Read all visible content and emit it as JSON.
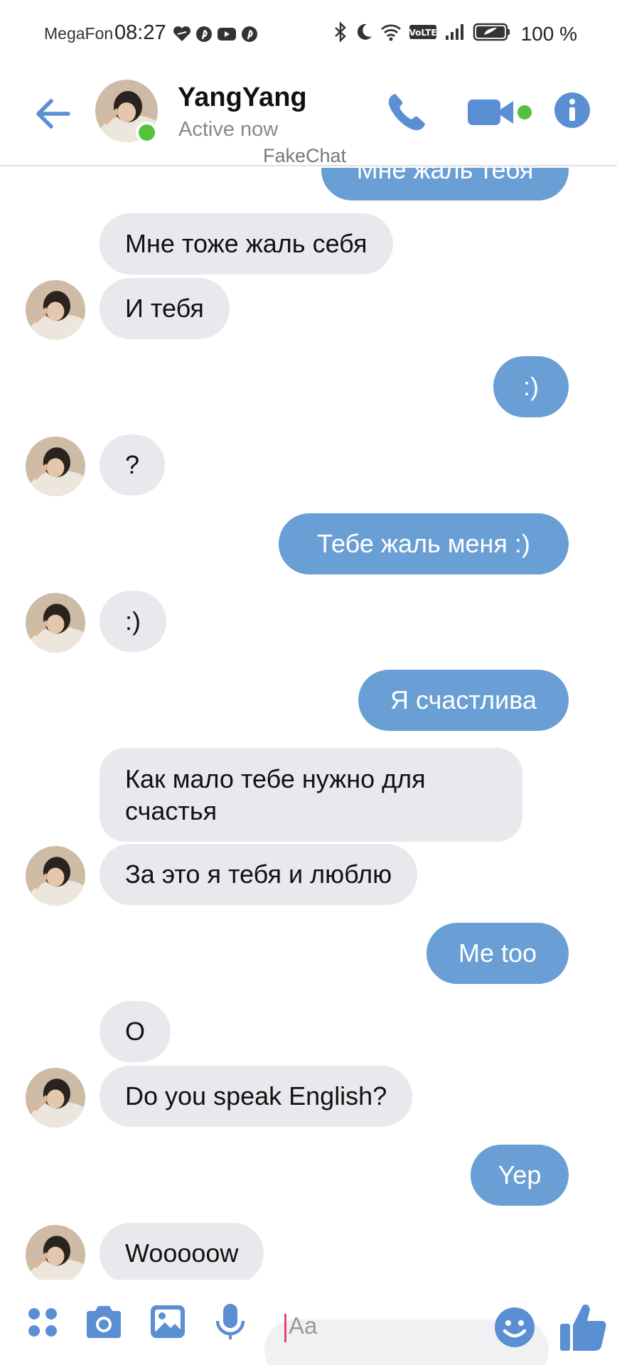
{
  "status_bar": {
    "carrier": "MegaFon",
    "time": "08:27",
    "notification_icons": [
      "heart-icon",
      "pinterest-icon",
      "youtube-icon",
      "pinterest-icon"
    ],
    "right_icons": [
      "bluetooth-icon",
      "moon-icon",
      "wifi-icon",
      "volte-icon",
      "signal-icon",
      "battery-icon"
    ],
    "volte_label": "VoLTE",
    "battery_text": "100 %"
  },
  "header": {
    "contact_name": "YangYang",
    "contact_status": "Active now",
    "watermark": "FakeChat"
  },
  "messages": [
    {
      "side": "out",
      "text": "Мне жаль тебя"
    },
    {
      "side": "in",
      "text": "Мне тоже жаль себя"
    },
    {
      "side": "in",
      "text": "И тебя"
    },
    {
      "side": "out",
      "text": ":)"
    },
    {
      "side": "in",
      "text": "?"
    },
    {
      "side": "out",
      "text": "Тебе жаль меня :)"
    },
    {
      "side": "in",
      "text": ":)"
    },
    {
      "side": "out",
      "text": "Я счастлива"
    },
    {
      "side": "in",
      "text": "Как мало тебе нужно для счастья"
    },
    {
      "side": "in",
      "text": "За это я тебя и люблю"
    },
    {
      "side": "out",
      "text": "Me too"
    },
    {
      "side": "in",
      "text": "O"
    },
    {
      "side": "in",
      "text": "Do you speak English?"
    },
    {
      "side": "out",
      "text": "Yep"
    },
    {
      "side": "in",
      "text": "Wooooow"
    }
  ],
  "composer": {
    "placeholder": "Aa",
    "icons": [
      "apps-icon",
      "camera-icon",
      "image-icon",
      "microphone-icon",
      "emoji-icon",
      "thumbs-up-icon"
    ]
  },
  "colors": {
    "accent": "#5b8fd4",
    "outgoing_bubble": "#6a9fd6",
    "incoming_bubble": "#e9e8ed",
    "online": "#55c23e"
  }
}
